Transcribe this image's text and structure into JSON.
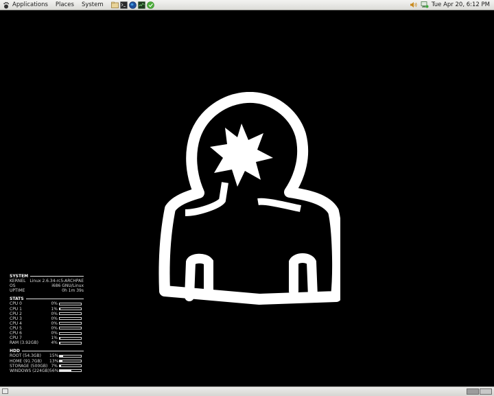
{
  "top_panel": {
    "menus": [
      "Applications",
      "Places",
      "System"
    ],
    "launchers": [
      "files-launcher-icon",
      "terminal-launcher-icon",
      "globe-browser-icon",
      "system-monitor-icon",
      "update-notifier-icon"
    ],
    "tray": [
      "volume-icon",
      "network-icon"
    ],
    "clock": "Tue Apr 20,  6:12 PM"
  },
  "conky": {
    "system": {
      "title": "SYSTEM",
      "rows": [
        {
          "k": "KERNEL",
          "v": "Linux 2.6.34-rc5-ARCHPAE"
        },
        {
          "k": "OS",
          "v": "i686 GNU/Linux"
        },
        {
          "k": "UPTIME",
          "v": "0h 1m 39s"
        }
      ]
    },
    "stats": {
      "title": "STATS",
      "rows": [
        {
          "k": "CPU 0",
          "v": "0%",
          "fill": 0
        },
        {
          "k": "CPU 1",
          "v": "1%",
          "fill": 1
        },
        {
          "k": "CPU 2",
          "v": "0%",
          "fill": 0
        },
        {
          "k": "CPU 3",
          "v": "0%",
          "fill": 0
        },
        {
          "k": "CPU 4",
          "v": "0%",
          "fill": 0
        },
        {
          "k": "CPU 5",
          "v": "0%",
          "fill": 0
        },
        {
          "k": "CPU 6",
          "v": "0%",
          "fill": 0
        },
        {
          "k": "CPU 7",
          "v": "1%",
          "fill": 1
        },
        {
          "k": "RAM (3.92GB)",
          "v": "4%",
          "fill": 4
        }
      ]
    },
    "hdd": {
      "title": "HDD",
      "rows": [
        {
          "k": "ROOT (54.3GB)",
          "v": "15%",
          "fill": 15
        },
        {
          "k": "HOME (91.7GB)",
          "v": "13%",
          "fill": 13
        },
        {
          "k": "STORAGE (500GB)",
          "v": "7%",
          "fill": 7
        },
        {
          "k": "WINDOWS (224GB)",
          "v": "56%",
          "fill": 56
        }
      ]
    }
  },
  "colors": {
    "desktop_bg": "#000000",
    "logo": "#ffffff",
    "panel": "#e4e4e1"
  }
}
